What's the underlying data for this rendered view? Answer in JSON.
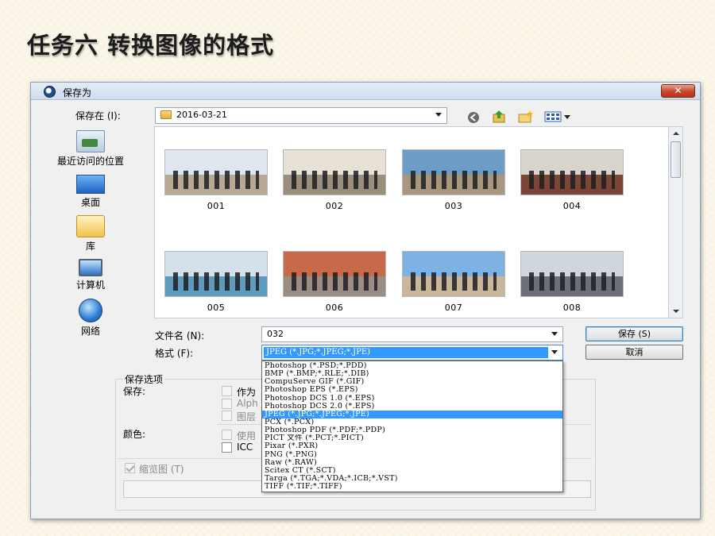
{
  "slide": {
    "title": "任务六 转换图像的格式"
  },
  "dialog": {
    "title": "保存为",
    "close_label": "✕",
    "save_in_label": "保存在 (I):",
    "save_in_value": "2016-03-21",
    "places": [
      {
        "id": "recent",
        "label": "最近访问的位置"
      },
      {
        "id": "desktop",
        "label": "桌面"
      },
      {
        "id": "library",
        "label": "库"
      },
      {
        "id": "computer",
        "label": "计算机"
      },
      {
        "id": "network",
        "label": "网络"
      }
    ],
    "files": [
      {
        "name": "001"
      },
      {
        "name": "002"
      },
      {
        "name": "003"
      },
      {
        "name": "004"
      },
      {
        "name": "005"
      },
      {
        "name": "006"
      },
      {
        "name": "007"
      },
      {
        "name": "008"
      }
    ],
    "filename_label": "文件名 (N):",
    "filename_value": "032",
    "format_label": "格式 (F):",
    "format_value": "JPEG (*.JPG;*.JPEG;*.JPE)",
    "save_button": "保存 (S)",
    "cancel_button": "取消",
    "options": {
      "group_title": "保存选项",
      "save_label": "保存:",
      "save_opt1": "作为",
      "save_opt2": "Alph",
      "save_opt3": "图层",
      "color_label": "颜色:",
      "color_opt1": "使用",
      "color_opt2": "ICC",
      "thumbnail_label": "缩览图 (T)"
    },
    "format_options": [
      "Photoshop (*.PSD;*.PDD)",
      "BMP (*.BMP;*.RLE;*.DIB)",
      "CompuServe GIF (*.GIF)",
      "Photoshop EPS (*.EPS)",
      "Photoshop DCS 1.0 (*.EPS)",
      "Photoshop DCS 2.0 (*.EPS)",
      "JPEG (*.JPG;*.JPEG;*.JPE)",
      "PCX (*.PCX)",
      "Photoshop PDF (*.PDF;*.PDP)",
      "PICT 文件 (*.PCT;*.PICT)",
      "Pixar (*.PXR)",
      "PNG (*.PNG)",
      "Raw (*.RAW)",
      "Scitex CT (*.SCT)",
      "Targa (*.TGA;*.VDA;*.ICB;*.VST)",
      "TIFF (*.TIF;*.TIFF)"
    ],
    "format_selected": "JPEG (*.JPG;*.JPEG;*.JPE)"
  }
}
